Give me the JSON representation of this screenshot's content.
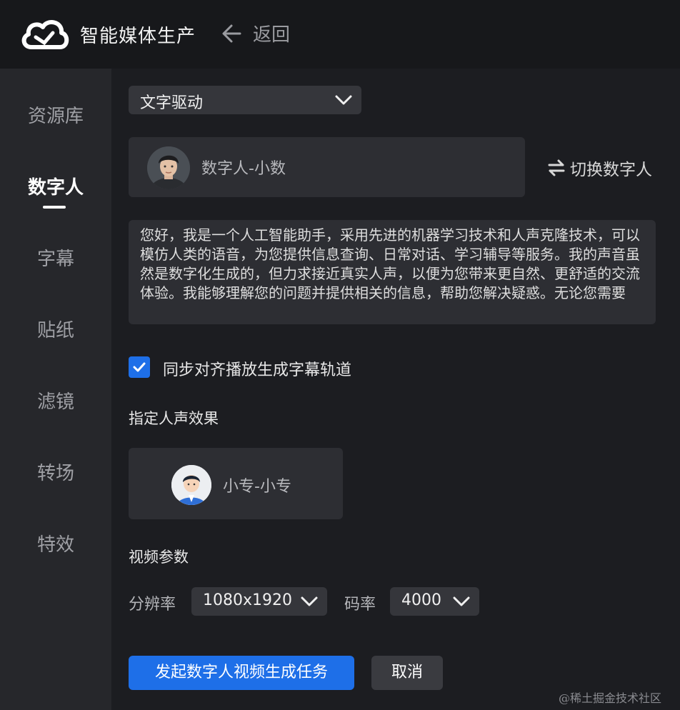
{
  "header": {
    "app_title": "智能媒体生产",
    "back_label": "返回"
  },
  "sidebar": {
    "items": [
      {
        "label": "资源库"
      },
      {
        "label": "数字人",
        "active": true
      },
      {
        "label": "字幕"
      },
      {
        "label": "贴纸"
      },
      {
        "label": "滤镜"
      },
      {
        "label": "转场"
      },
      {
        "label": "特效"
      }
    ]
  },
  "main": {
    "mode_select": "文字驱动",
    "digital_human": {
      "name": "数字人-小数",
      "switch_label": "切换数字人"
    },
    "script_text": "您好，我是一个人工智能助手，采用先进的机器学习技术和人声克隆技术，可以模仿人类的语音，为您提供信息查询、日常对话、学习辅导等服务。我的声音虽然是数字化生成的，但力求接近真实人声，以便为您带来更自然、更舒适的交流体验。我能够理解您的问题并提供相关的信息，帮助您解决疑惑。无论您需要",
    "sync_subtitle": {
      "checked": true,
      "label": "同步对齐播放生成字幕轨道"
    },
    "voice_section_label": "指定人声效果",
    "voice": {
      "name": "小专-小专"
    },
    "video_params": {
      "section_label": "视频参数",
      "resolution_label": "分辨率",
      "resolution_value": "1080x1920",
      "bitrate_label": "码率",
      "bitrate_value": "4000"
    },
    "actions": {
      "submit_label": "发起数字人视频生成任务",
      "cancel_label": "取消"
    }
  },
  "watermark": "@稀土掘金技术社区",
  "colors": {
    "primary": "#1e6fe8",
    "topbar_bg": "#17181b",
    "sidebar_bg": "#26272b",
    "main_bg": "#1c1d21",
    "card_bg": "#2d2e33"
  }
}
